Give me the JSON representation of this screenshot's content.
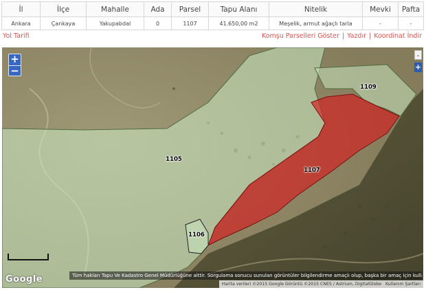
{
  "table": {
    "headers": [
      "İl",
      "İlçe",
      "Mahalle",
      "Ada",
      "Parsel",
      "Tapu Alanı",
      "Nitelik",
      "Mevki",
      "Pafta"
    ],
    "row": [
      "Ankara",
      "Çankaya",
      "Yakupabdal",
      "0",
      "1107",
      "41.650,00 m2",
      "Meşelik, armut ağaçlı tarla",
      "-",
      "-"
    ]
  },
  "links": {
    "route": "Yol Tarifi",
    "neighbors": "Komşu Parselleri Göster",
    "print": "Yazdır",
    "coords": "Koordinat İndir",
    "separator": "|"
  },
  "map": {
    "zoom_in": "+",
    "zoom_out": "−",
    "side_minus": "-",
    "side_plus": "+",
    "parcels": [
      {
        "id": "1105",
        "highlighted": false
      },
      {
        "id": "1106",
        "highlighted": false
      },
      {
        "id": "1107",
        "highlighted": true
      },
      {
        "id": "1109",
        "highlighted": false
      }
    ],
    "logo": "Google",
    "disclaimer": "Tüm hakları Tapu Ve Kadastro Genel Müdürlüğüne aittir. Sorgulama sonucu sunulan görüntüler bilgilendirme amaçlı olup, başka bir amaç için kullanılamaz.",
    "attribution": "Harita verileri ©2015 Google Görüntü ©2015 CNES / Astrium, DigitalGlobe",
    "terms": "Kullanım Şartları"
  },
  "colors": {
    "link": "#d9534f",
    "parcel_fill": "#c8e6c0",
    "selected_parcel_fill": "#d32020",
    "zoom_control": "#3867c2"
  },
  "icons": {
    "zoom_in": "plus-icon",
    "zoom_out": "minus-icon",
    "scale": "scale-bar-icon"
  }
}
